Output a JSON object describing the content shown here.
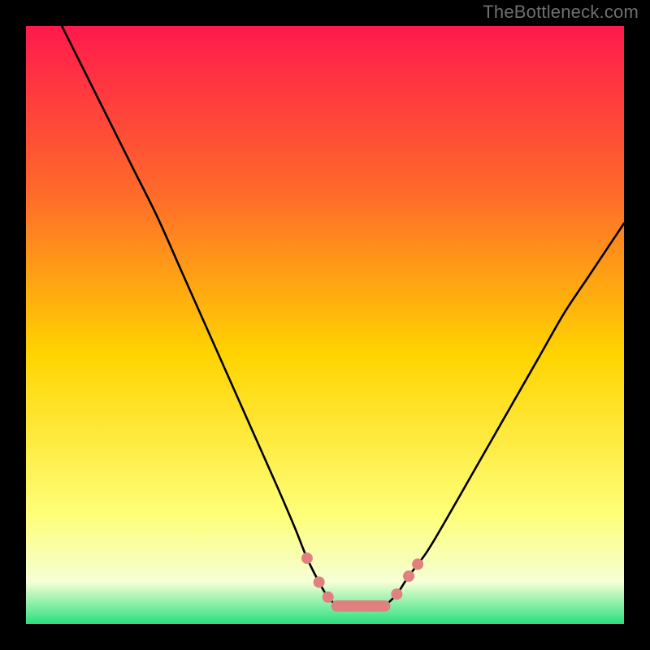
{
  "attribution": "TheBottleneck.com",
  "chart_data": {
    "type": "line",
    "title": "",
    "xlabel": "",
    "ylabel": "",
    "xlim": [
      0,
      100
    ],
    "ylim": [
      0,
      100
    ],
    "gradient_colors": {
      "top": "#ff1a4c",
      "upper": "#ff6a2a",
      "mid": "#ffd400",
      "lower": "#feff7a",
      "pale": "#f5ffd5",
      "bottom": "#28e07e"
    },
    "left_curve": {
      "comment": "Descending stroke of the V, starts near top-left edge and drops to the trough",
      "x": [
        6,
        10,
        14,
        18,
        22,
        26,
        30,
        34,
        38,
        42,
        45,
        47,
        49,
        50.5,
        52
      ],
      "y": [
        100,
        92,
        84,
        76,
        68,
        59,
        50,
        41,
        32,
        23,
        16,
        11,
        7,
        4.5,
        3
      ]
    },
    "right_curve": {
      "comment": "Ascending stroke, rises from trough toward upper right, ends off-canvas",
      "x": [
        60,
        62,
        64,
        67,
        70,
        74,
        78,
        82,
        86,
        90,
        94,
        98,
        100
      ],
      "y": [
        3,
        5,
        8,
        12,
        17,
        24,
        31,
        38,
        45,
        52,
        58,
        64,
        67
      ]
    },
    "trough_flat": {
      "x": [
        52,
        60
      ],
      "y": [
        3,
        3
      ]
    },
    "markers": {
      "comment": "Salmon dots/lozenges near the trough on both limbs",
      "points": [
        {
          "x": 47,
          "y": 11
        },
        {
          "x": 49,
          "y": 7
        },
        {
          "x": 50.5,
          "y": 4.5
        },
        {
          "x": 62,
          "y": 5
        },
        {
          "x": 64,
          "y": 8
        },
        {
          "x": 65.5,
          "y": 10
        }
      ],
      "bar": {
        "x0": 52,
        "x1": 60,
        "y": 3
      }
    },
    "colors": {
      "curve": "#000000",
      "marker": "#e08080"
    }
  }
}
